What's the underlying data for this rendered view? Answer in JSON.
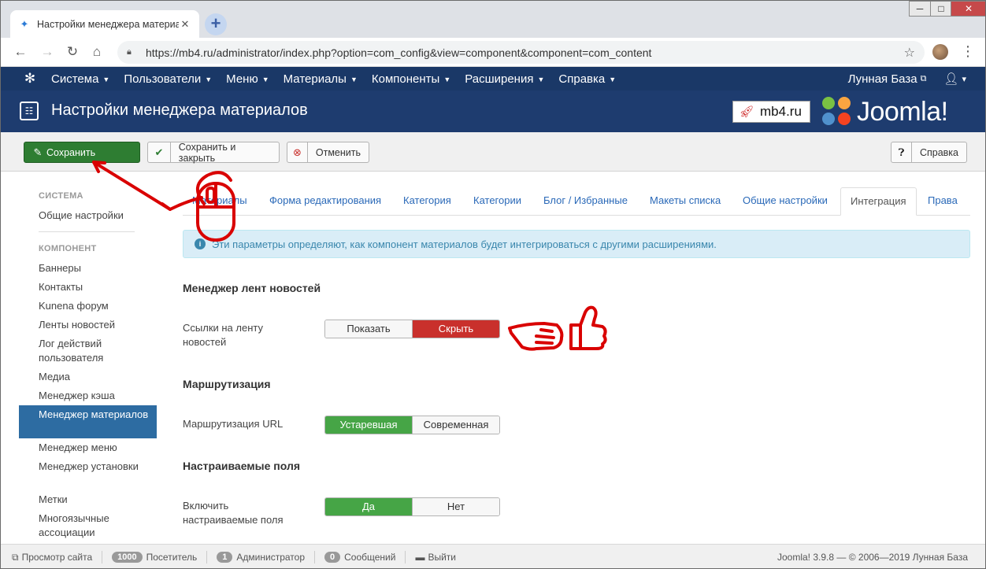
{
  "browser": {
    "tab_title": "Настройки менеджера материалов",
    "new_tab_symbol": "+",
    "url": "https://mb4.ru/administrator/index.php?option=com_config&view=component&component=com_content",
    "win_minimize": "─",
    "win_maximize": "□",
    "win_close": "✕"
  },
  "navbar": {
    "items": [
      "Система",
      "Пользователи",
      "Меню",
      "Материалы",
      "Компоненты",
      "Расширения",
      "Справка"
    ],
    "site_name": "Лунная База",
    "user_menu_caret": "▾"
  },
  "header": {
    "title": "Настройки менеджера материалов",
    "mb4_label": "mb4.ru",
    "joomla_label": "Joomla!"
  },
  "toolbar": {
    "save": "Сохранить",
    "save_close": "Сохранить и закрыть",
    "cancel": "Отменить",
    "help": "Справка"
  },
  "sidebar": {
    "system_heading": "СИСТЕМА",
    "general": "Общие настройки",
    "component_heading": "КОМПОНЕНТ",
    "items": [
      "Баннеры",
      "Контакты",
      "Kunena форум",
      "Ленты новостей",
      "Лог действий пользователя",
      "Медиа",
      "Менеджер кэша",
      "Менеджер материалов",
      "Менеджер меню",
      "Менеджер установки",
      "Метки",
      "Многоязычные ассоциации"
    ]
  },
  "tabs": [
    "Материалы",
    "Форма редактирования",
    "Категория",
    "Категории",
    "Блог / Избранные",
    "Макеты списка",
    "Общие настройки",
    "Интеграция",
    "Права"
  ],
  "alert_text": "Эти параметры определяют, как компонент материалов будет интегрироваться с другими расширениями.",
  "sections": {
    "feeds": {
      "heading": "Менеджер лент новостей",
      "label": "Ссылки на ленту новостей",
      "options": [
        "Показать",
        "Скрыть"
      ],
      "selected": "Скрыть"
    },
    "routing": {
      "heading": "Маршрутизация",
      "label": "Маршрутизация URL",
      "options": [
        "Устаревшая",
        "Современная"
      ],
      "selected": "Устаревшая"
    },
    "fields": {
      "heading": "Настраиваемые поля",
      "label": "Включить настраиваемые поля",
      "options": [
        "Да",
        "Нет"
      ],
      "selected": "Да"
    }
  },
  "statusbar": {
    "view_site": "Просмотр сайта",
    "visitors_count": "1000",
    "visitors_label": "Посетитель",
    "admins_count": "1",
    "admins_label": "Администратор",
    "messages_count": "0",
    "messages_label": "Сообщений",
    "logout": "Выйти",
    "version": "Joomla! 3.9.8",
    "copyright": "© 2006—2019 Лунная База"
  },
  "colors": {
    "navbar": "#1a3867",
    "header": "#1e3c6f",
    "save_green": "#2e7d32",
    "active_sidebar": "#2d6ca2",
    "hide_red": "#c9302c",
    "option_green": "#46a546",
    "annotation_red": "#d90000"
  },
  "icons": {
    "favicon": "satellite-icon",
    "lock": "lock-icon",
    "star": "star-icon",
    "menu": "kebab-menu-icon",
    "joomla": "joomla-icon",
    "config": "sliders-icon",
    "save": "edit-icon",
    "save_close": "check-icon",
    "cancel": "cancel-icon",
    "help": "question-icon",
    "info": "info-icon"
  }
}
